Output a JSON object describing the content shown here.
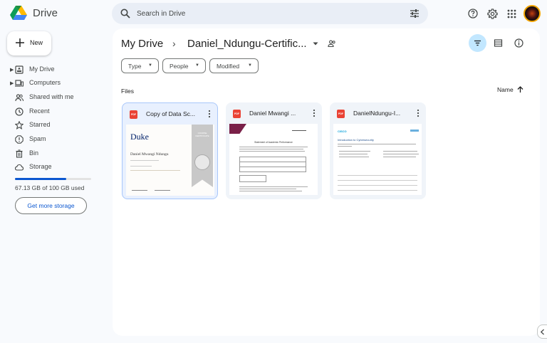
{
  "app": {
    "name": "Drive"
  },
  "search": {
    "placeholder": "Search in Drive"
  },
  "sidebar": {
    "new_label": "New",
    "items": [
      {
        "label": "My Drive",
        "icon": "my-drive-icon"
      },
      {
        "label": "Computers",
        "icon": "computers-icon"
      },
      {
        "label": "Shared with me",
        "icon": "shared-icon"
      },
      {
        "label": "Recent",
        "icon": "clock-icon"
      },
      {
        "label": "Starred",
        "icon": "star-icon"
      },
      {
        "label": "Spam",
        "icon": "spam-icon"
      },
      {
        "label": "Bin",
        "icon": "bin-icon"
      },
      {
        "label": "Storage",
        "icon": "cloud-icon"
      }
    ],
    "storage": {
      "text": "67.13 GB of 100 GB used",
      "used_fraction": 0.6713,
      "cta": "Get more storage"
    }
  },
  "breadcrumb": {
    "root": "My Drive",
    "separator": "›",
    "current": "Daniel_Ndungu-Certific..."
  },
  "filters": [
    "Type",
    "People",
    "Modified"
  ],
  "section": {
    "title": "Files",
    "sort_label": "Name"
  },
  "files": [
    {
      "title": "Copy of Data Sc...",
      "type": "PDF",
      "selected": true,
      "thumb": {
        "brand": "Duke",
        "name_line": "Daniel Mwangi Ndungu",
        "badge": "COURSE CERTIFICATE"
      }
    },
    {
      "title": "Daniel Mwangi ...",
      "type": "PDF",
      "selected": false,
      "thumb": {
        "heading": "Statement of Academic Performance"
      }
    },
    {
      "title": "DanielNdungu-I...",
      "type": "PDF",
      "selected": false,
      "thumb": {
        "brand": "CISCO",
        "heading": "Introduction to Cybersecurity"
      }
    }
  ],
  "colors": {
    "accent": "#0b57d0",
    "selected_chip": "#c2e7ff",
    "pdf_red": "#ea4335"
  }
}
